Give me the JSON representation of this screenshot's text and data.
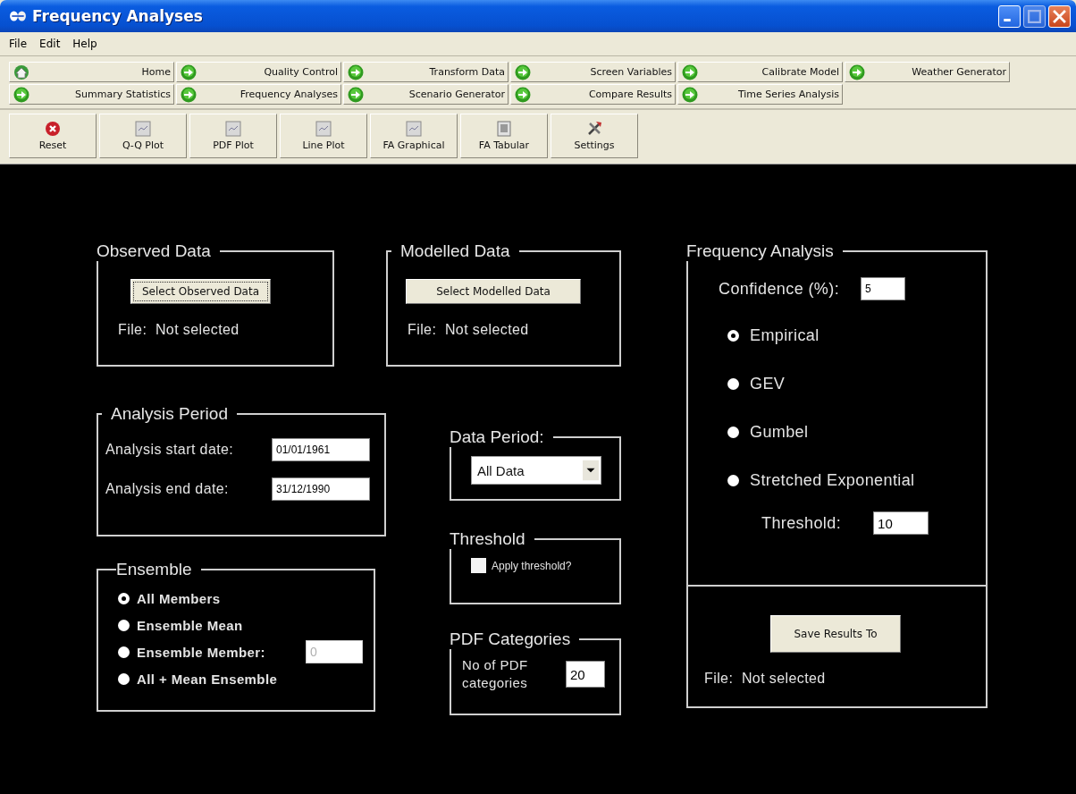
{
  "window": {
    "title": "Frequency Analyses"
  },
  "menu": [
    "File",
    "Edit",
    "Help"
  ],
  "nav_rows": [
    [
      "Home",
      "Quality Control",
      "Transform Data",
      "Screen Variables",
      "Calibrate Model",
      "Weather Generator"
    ],
    [
      "Summary Statistics",
      "Frequency Analyses",
      "Scenario Generator",
      "Compare Results",
      "Time Series Analysis"
    ]
  ],
  "toolbar": [
    "Reset",
    "Q-Q Plot",
    "PDF Plot",
    "Line Plot",
    "FA Graphical",
    "FA Tabular",
    "Settings"
  ],
  "observed_data": {
    "title": "Observed Data",
    "button": "Select Observed Data",
    "file": "File:  Not selected"
  },
  "modelled_data": {
    "title": "Modelled Data",
    "button": "Select Modelled Data",
    "file": "File:  Not selected"
  },
  "analysis_period": {
    "title": "Analysis Period",
    "fields": [
      {
        "label": "Analysis start date:",
        "value": "01/01/1961"
      },
      {
        "label": "Analysis end date:",
        "value": "31/12/1990"
      }
    ]
  },
  "ensemble": {
    "title": "Ensemble",
    "options": [
      {
        "label": "All Members",
        "selected": true
      },
      {
        "label": "Ensemble Mean",
        "selected": false
      },
      {
        "label": "Ensemble Member:",
        "selected": false,
        "field": {
          "value": "0",
          "disabled": true
        }
      },
      {
        "label": "All + Mean Ensemble",
        "selected": false
      }
    ]
  },
  "data_period": {
    "title": "Data Period:",
    "value": "All Data"
  },
  "threshold": {
    "title": "Threshold",
    "checkbox": {
      "label": "Apply threshold?",
      "checked": false
    }
  },
  "pdf_categories": {
    "title": "PDF Categories",
    "label": "No of PDF categories",
    "value": "20"
  },
  "frequency_analysis": {
    "title": "Frequency Analysis",
    "confidence": {
      "label": "Confidence (%):",
      "value": "5"
    },
    "methods": [
      {
        "label": "Empirical",
        "selected": true
      },
      {
        "label": "GEV",
        "selected": false
      },
      {
        "label": "Gumbel",
        "selected": false
      },
      {
        "label": "Stretched Exponential",
        "selected": false
      }
    ],
    "threshold": {
      "label": "Threshold:",
      "value": "10"
    },
    "save_button": "Save Results To",
    "file": "File:  Not selected"
  }
}
